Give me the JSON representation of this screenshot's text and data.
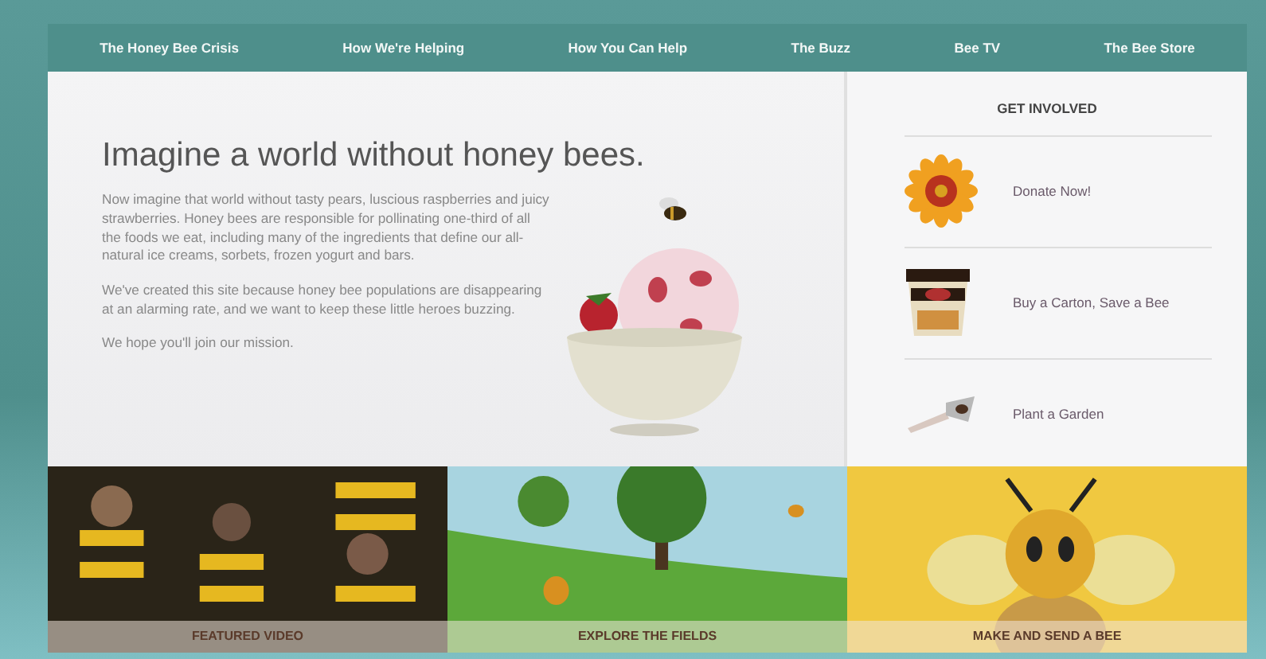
{
  "nav": [
    {
      "label": "The Honey Bee Crisis"
    },
    {
      "label": "How We're Helping"
    },
    {
      "label": "How You Can Help"
    },
    {
      "label": "The Buzz"
    },
    {
      "label": "Bee TV"
    },
    {
      "label": "The Bee Store"
    }
  ],
  "hero": {
    "title": "Imagine a world without honey bees.",
    "paragraphs": [
      "Now imagine that world without tasty pears, luscious raspberries and juicy strawberries. Honey bees are responsible for pollinating one-third of all the foods we eat, including many of the ingredients that define our all-natural ice creams, sorbets, frozen yogurt and bars.",
      "We've created this site because honey bee populations are disappearing at an alarming rate, and we want to keep these little heroes buzzing.",
      "We hope you'll join our mission."
    ]
  },
  "get_involved": {
    "title": "GET INVOLVED",
    "items": [
      {
        "kind": "flower",
        "label": "Donate Now!"
      },
      {
        "kind": "carton",
        "label": "Buy a Carton, Save a Bee"
      },
      {
        "kind": "trowel",
        "label": "Plant a Garden"
      }
    ]
  },
  "tiles": [
    {
      "kind": "video",
      "label": "FEATURED VIDEO"
    },
    {
      "kind": "fields",
      "label": "EXPLORE THE FIELDS"
    },
    {
      "kind": "bee",
      "label": "MAKE AND SEND A BEE"
    }
  ]
}
